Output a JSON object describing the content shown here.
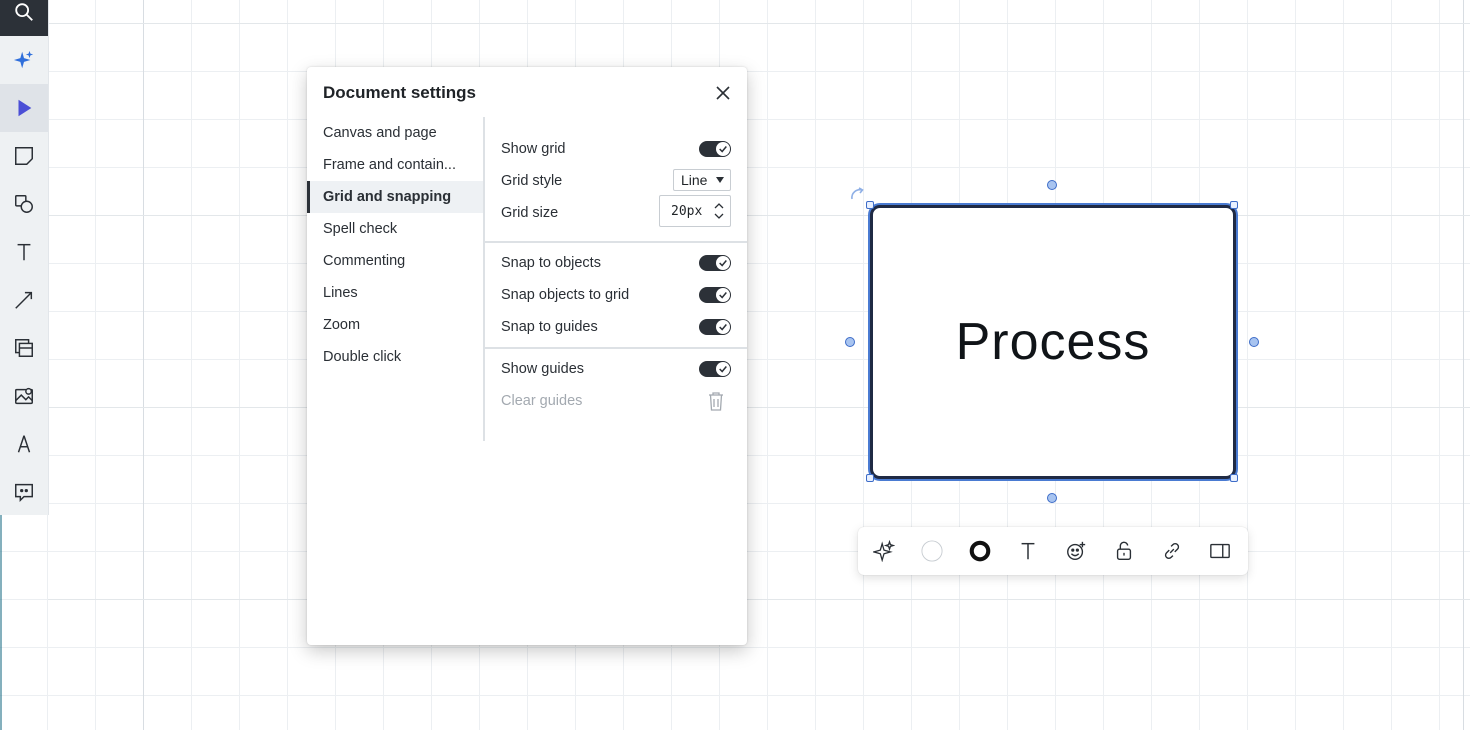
{
  "dialog": {
    "title": "Document settings",
    "nav": [
      {
        "label": "Canvas and page"
      },
      {
        "label": "Frame and contain..."
      },
      {
        "label": "Grid and snapping",
        "selected": true
      },
      {
        "label": "Spell check"
      },
      {
        "label": "Commenting"
      },
      {
        "label": "Lines"
      },
      {
        "label": "Zoom"
      },
      {
        "label": "Double click"
      }
    ],
    "grid": {
      "show_grid_label": "Show grid",
      "show_grid_on": true,
      "grid_style_label": "Grid style",
      "grid_style_value": "Line",
      "grid_size_label": "Grid size",
      "grid_size_value": "20px"
    },
    "snapping": {
      "snap_objects_label": "Snap to objects",
      "snap_objects_on": true,
      "snap_grid_label": "Snap objects to grid",
      "snap_grid_on": true,
      "snap_guides_label": "Snap to guides",
      "snap_guides_on": true
    },
    "guides": {
      "show_guides_label": "Show guides",
      "show_guides_on": true,
      "clear_guides_label": "Clear guides"
    }
  },
  "canvas": {
    "shape_text": "Process"
  },
  "toolbar": {
    "tools": [
      "search-icon",
      "ai-sparkle-icon",
      "select-pointer-icon",
      "sticky-note-icon",
      "shapes-icon",
      "text-icon",
      "line-icon",
      "frame-icon",
      "image-icon",
      "pen-icon",
      "comment-icon"
    ],
    "active_tool": "select-pointer-icon"
  },
  "colors": {
    "accent": "#2c3138",
    "selection": "#3d6cc8",
    "ai_blue": "#2f6fdb",
    "pointer_purple": "#4b4fd6"
  }
}
